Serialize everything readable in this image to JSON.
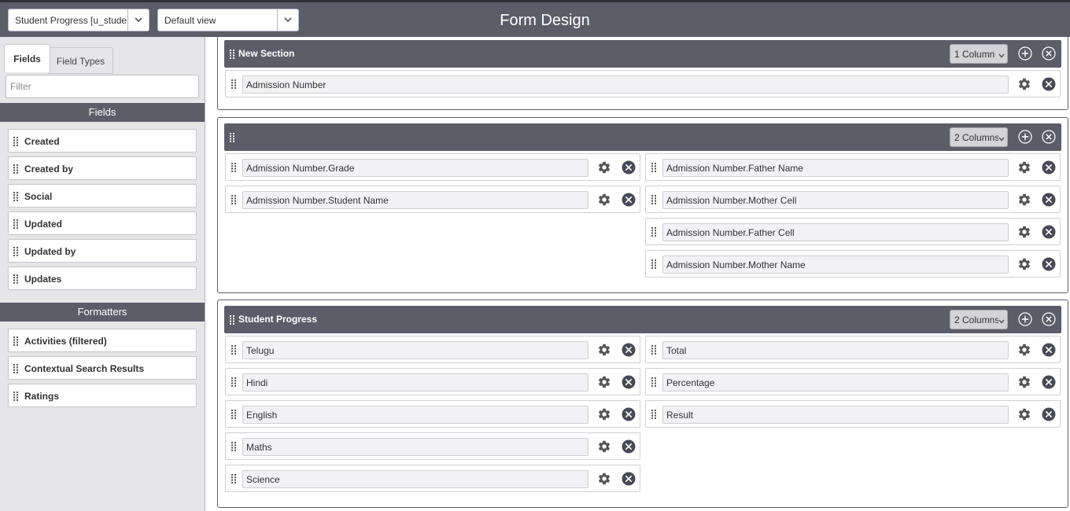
{
  "header": {
    "table_select": "Student Progress [u_student_progress]",
    "view_select": "Default view",
    "title": "Form Design"
  },
  "sidebar": {
    "tabs": [
      "Fields",
      "Field Types"
    ],
    "filter_placeholder": "Filter",
    "fields_heading": "Fields",
    "fields": [
      "Created",
      "Created by",
      "Social",
      "Updated",
      "Updated by",
      "Updates"
    ],
    "formatters_heading": "Formatters",
    "formatters": [
      "Activities (filtered)",
      "Contextual Search Results",
      "Ratings"
    ]
  },
  "sections": [
    {
      "title": "New Section",
      "columns_label": "1 Column",
      "left": [
        "Admission Number"
      ],
      "right": []
    },
    {
      "title": "",
      "columns_label": "2 Columns",
      "left": [
        "Admission Number.Grade",
        "Admission Number.Student Name"
      ],
      "right": [
        "Admission Number.Father Name",
        "Admission Number.Mother Cell",
        "Admission Number.Father Cell",
        "Admission Number.Mother Name"
      ]
    },
    {
      "title": "Student Progress",
      "columns_label": "2 Columns",
      "left": [
        "Telugu",
        "Hindi",
        "English",
        "Maths",
        "Science"
      ],
      "right": [
        "Total",
        "Percentage",
        "Result"
      ]
    }
  ],
  "icons": {
    "drag": "drag-handle-icon",
    "settings": "gear-icon",
    "remove": "close-circle-icon",
    "add": "plus-circle-icon",
    "dropdown": "chevron-down-icon"
  },
  "colors": {
    "header_bg": "#5d5d69",
    "sidebar_bg": "#e6e6e8"
  }
}
